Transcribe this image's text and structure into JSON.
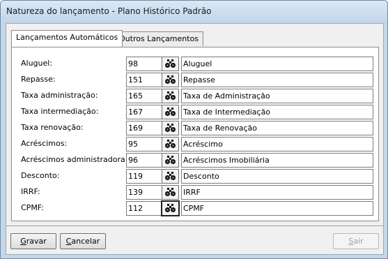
{
  "window": {
    "title": "Natureza do lançamento - Plano Histórico Padrão"
  },
  "tabs": [
    {
      "label": "Lançamentos Automáticos",
      "active": true
    },
    {
      "label": "Outros Lançamentos",
      "active": false
    }
  ],
  "search_icon": "binoculars-icon",
  "rows": [
    {
      "label": "Aluguel:",
      "code": "98",
      "description": "Aluguel"
    },
    {
      "label": "Repasse:",
      "code": "151",
      "description": "Repasse"
    },
    {
      "label": "Taxa administração:",
      "code": "165",
      "description": "Taxa de Administração"
    },
    {
      "label": "Taxa intermediação:",
      "code": "167",
      "description": "Taxa de Intermediação"
    },
    {
      "label": "Taxa renovação:",
      "code": "169",
      "description": "Taxa de Renovação"
    },
    {
      "label": "Acréscimos:",
      "code": "95",
      "description": "Acréscimo"
    },
    {
      "label": "Acréscimos administradora:",
      "code": "96",
      "description": "Acréscimos Imobiliária"
    },
    {
      "label": "Desconto:",
      "code": "119",
      "description": "Desconto"
    },
    {
      "label": "IRRF:",
      "code": "139",
      "description": "IRRF"
    },
    {
      "label": "CPMF:",
      "code": "112",
      "description": "CPMF"
    }
  ],
  "buttons": {
    "save": {
      "first": "G",
      "rest": "ravar"
    },
    "cancel": {
      "first": "C",
      "rest": "ancelar"
    },
    "exit": {
      "first": "S",
      "rest": "air"
    }
  }
}
